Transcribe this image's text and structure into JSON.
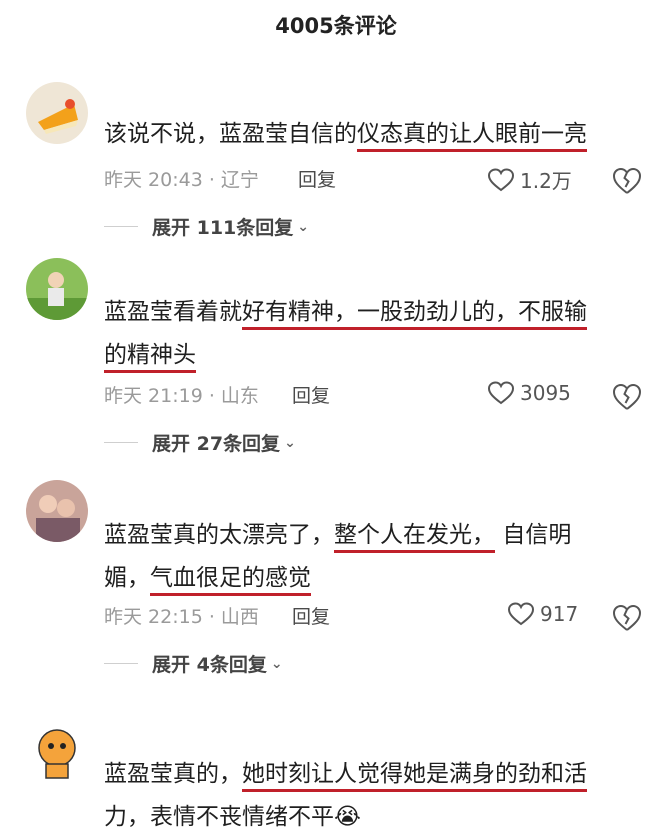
{
  "header": {
    "title": "4005条评论"
  },
  "comments": [
    {
      "segments": [
        "该说不说，蓝盈莹自信的",
        "仪态真的让人眼前一亮",
        ""
      ],
      "line2": [
        "",
        "",
        ""
      ],
      "time": "昨天 20:43 · 辽宁",
      "reply_label": "回复",
      "likes": "1.2万",
      "expand": "展开 111条回复"
    },
    {
      "segments": [
        "蓝盈莹看着就",
        "好有精神，一股劲劲儿的，不服输",
        ""
      ],
      "line2": [
        "",
        "的精神头",
        ""
      ],
      "time": "昨天 21:19 · 山东",
      "reply_label": "回复",
      "likes": "3095",
      "expand": "展开 27条回复"
    },
    {
      "segments": [
        "蓝盈莹真的太漂亮了，",
        "整个人在发光，",
        "自信明"
      ],
      "line2": [
        "媚，",
        "气血很足的感觉",
        ""
      ],
      "time": "昨天 22:15 · 山西",
      "reply_label": "回复",
      "likes": "917",
      "expand": "展开 4条回复"
    },
    {
      "segments": [
        "蓝盈莹真的，",
        "她时刻让人觉得她是满身的劲和活",
        ""
      ],
      "line2": [
        "力，表情不丧情绪不平",
        "",
        ""
      ],
      "emoji": "😭"
    }
  ]
}
